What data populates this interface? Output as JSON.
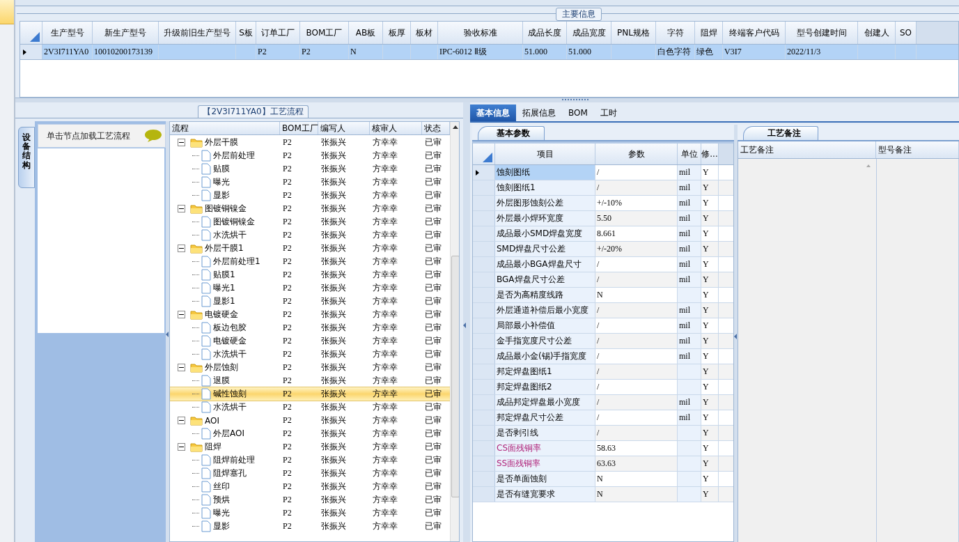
{
  "main_info": {
    "title": "主要信息",
    "columns": [
      "生产型号",
      "新生产型号",
      "升级前旧生产型号",
      "S板",
      "订单工厂",
      "BOM工厂",
      "AB板",
      "板厚",
      "板材",
      "验收标准",
      "成品长度",
      "成品宽度",
      "PNL规格",
      "字符",
      "阻焊",
      "终端客户代码",
      "型号创建时间",
      "创建人",
      "SO"
    ],
    "rows": [
      {
        "selected": true,
        "cells": [
          "2V3I711YA0",
          "10010200173139",
          null,
          null,
          "P2",
          "P2",
          "N",
          null,
          null,
          "IPC-6012 Ⅱ级",
          "51.000",
          "51.000",
          null,
          "白色字符",
          "绿色",
          "V3I7",
          "2022/11/3",
          null,
          null
        ]
      }
    ]
  },
  "process": {
    "title": "【2V3I711YA0】工艺流程",
    "side_tab": "设备结构",
    "hint": "单击节点加载工艺流程",
    "columns": [
      "流程",
      "BOM工厂",
      "编写人",
      "核审人",
      "状态"
    ],
    "tree": [
      {
        "name": "外层干膜",
        "bom": "P2",
        "writer": "张振兴",
        "reviewer": "方幸幸",
        "status": "已审",
        "selected": false,
        "expanded": true,
        "children": [
          {
            "name": "外层前处理",
            "bom": "P2",
            "writer": "张振兴",
            "reviewer": "方幸幸",
            "status": "已审",
            "selected": false
          },
          {
            "name": "贴膜",
            "bom": "P2",
            "writer": "张振兴",
            "reviewer": "方幸幸",
            "status": "已审",
            "selected": false
          },
          {
            "name": "曝光",
            "bom": "P2",
            "writer": "张振兴",
            "reviewer": "方幸幸",
            "status": "已审",
            "selected": false
          },
          {
            "name": "显影",
            "bom": "P2",
            "writer": "张振兴",
            "reviewer": "方幸幸",
            "status": "已审",
            "selected": false
          }
        ]
      },
      {
        "name": "图镀铜镍金",
        "bom": "P2",
        "writer": "张振兴",
        "reviewer": "方幸幸",
        "status": "已审",
        "selected": false,
        "expanded": true,
        "children": [
          {
            "name": "图镀铜镍金",
            "bom": "P2",
            "writer": "张振兴",
            "reviewer": "方幸幸",
            "status": "已审",
            "selected": false
          },
          {
            "name": "水洗烘干",
            "bom": "P2",
            "writer": "张振兴",
            "reviewer": "方幸幸",
            "status": "已审",
            "selected": false
          }
        ]
      },
      {
        "name": "外层干膜1",
        "bom": "P2",
        "writer": "张振兴",
        "reviewer": "方幸幸",
        "status": "已审",
        "selected": false,
        "expanded": true,
        "children": [
          {
            "name": "外层前处理1",
            "bom": "P2",
            "writer": "张振兴",
            "reviewer": "方幸幸",
            "status": "已审",
            "selected": false
          },
          {
            "name": "贴膜1",
            "bom": "P2",
            "writer": "张振兴",
            "reviewer": "方幸幸",
            "status": "已审",
            "selected": false
          },
          {
            "name": "曝光1",
            "bom": "P2",
            "writer": "张振兴",
            "reviewer": "方幸幸",
            "status": "已审",
            "selected": false
          },
          {
            "name": "显影1",
            "bom": "P2",
            "writer": "张振兴",
            "reviewer": "方幸幸",
            "status": "已审",
            "selected": false
          }
        ]
      },
      {
        "name": "电镀硬金",
        "bom": "P2",
        "writer": "张振兴",
        "reviewer": "方幸幸",
        "status": "已审",
        "selected": false,
        "expanded": true,
        "children": [
          {
            "name": "板边包胶",
            "bom": "P2",
            "writer": "张振兴",
            "reviewer": "方幸幸",
            "status": "已审",
            "selected": false
          },
          {
            "name": "电镀硬金",
            "bom": "P2",
            "writer": "张振兴",
            "reviewer": "方幸幸",
            "status": "已审",
            "selected": false
          },
          {
            "name": "水洗烘干",
            "bom": "P2",
            "writer": "张振兴",
            "reviewer": "方幸幸",
            "status": "已审",
            "selected": false
          }
        ]
      },
      {
        "name": "外层蚀刻",
        "bom": "P2",
        "writer": "张振兴",
        "reviewer": "方幸幸",
        "status": "已审",
        "selected": false,
        "expanded": true,
        "children": [
          {
            "name": "退膜",
            "bom": "P2",
            "writer": "张振兴",
            "reviewer": "方幸幸",
            "status": "已审",
            "selected": false
          },
          {
            "name": "碱性蚀刻",
            "bom": "P2",
            "writer": "张振兴",
            "reviewer": "方幸幸",
            "status": "已审",
            "selected": true
          },
          {
            "name": "水洗烘干",
            "bom": "P2",
            "writer": "张振兴",
            "reviewer": "方幸幸",
            "status": "已审",
            "selected": false
          }
        ]
      },
      {
        "name": "AOI",
        "bom": "P2",
        "writer": "张振兴",
        "reviewer": "方幸幸",
        "status": "已审",
        "selected": false,
        "expanded": true,
        "children": [
          {
            "name": "外层AOI",
            "bom": "P2",
            "writer": "张振兴",
            "reviewer": "方幸幸",
            "status": "已审",
            "selected": false
          }
        ]
      },
      {
        "name": "阻焊",
        "bom": "P2",
        "writer": "张振兴",
        "reviewer": "方幸幸",
        "status": "已审",
        "selected": false,
        "expanded": true,
        "children": [
          {
            "name": "阻焊前处理",
            "bom": "P2",
            "writer": "张振兴",
            "reviewer": "方幸幸",
            "status": "已审",
            "selected": false
          },
          {
            "name": "阻焊塞孔",
            "bom": "P2",
            "writer": "张振兴",
            "reviewer": "方幸幸",
            "status": "已审",
            "selected": false
          },
          {
            "name": "丝印",
            "bom": "P2",
            "writer": "张振兴",
            "reviewer": "方幸幸",
            "status": "已审",
            "selected": false
          },
          {
            "name": "预烘",
            "bom": "P2",
            "writer": "张振兴",
            "reviewer": "方幸幸",
            "status": "已审",
            "selected": false
          },
          {
            "name": "曝光",
            "bom": "P2",
            "writer": "张振兴",
            "reviewer": "方幸幸",
            "status": "已审",
            "selected": false
          },
          {
            "name": "显影",
            "bom": "P2",
            "writer": "张振兴",
            "reviewer": "方幸幸",
            "status": "已审",
            "selected": false
          }
        ]
      }
    ]
  },
  "detail": {
    "tabs": [
      {
        "label": "基本信息",
        "selected": true
      },
      {
        "label": "拓展信息",
        "selected": false
      },
      {
        "label": "BOM",
        "selected": false
      },
      {
        "label": "工时",
        "selected": false
      }
    ],
    "subtab": "基本参数",
    "columns": [
      "项目",
      "参数",
      "单位",
      "修..."
    ],
    "rows": [
      {
        "item": "蚀刻图纸",
        "value": "/",
        "unit": "mil",
        "mod": "Y",
        "selected": true,
        "highlighted": false
      },
      {
        "item": "蚀刻图纸1",
        "value": "/",
        "unit": "mil",
        "mod": "Y",
        "selected": false,
        "highlighted": false
      },
      {
        "item": "外层图形蚀刻公差",
        "value": "+/-10%",
        "unit": "mil",
        "mod": "Y",
        "selected": false,
        "highlighted": false
      },
      {
        "item": "外层最小焊环宽度",
        "value": "5.50",
        "unit": "mil",
        "mod": "Y",
        "selected": false,
        "highlighted": false
      },
      {
        "item": "成品最小SMD焊盘宽度",
        "value": "8.661",
        "unit": "mil",
        "mod": "Y",
        "selected": false,
        "highlighted": false
      },
      {
        "item": "SMD焊盘尺寸公差",
        "value": "+/-20%",
        "unit": "mil",
        "mod": "Y",
        "selected": false,
        "highlighted": false
      },
      {
        "item": "成品最小BGA焊盘尺寸",
        "value": "/",
        "unit": "mil",
        "mod": "Y",
        "selected": false,
        "highlighted": false
      },
      {
        "item": "BGA焊盘尺寸公差",
        "value": "/",
        "unit": "mil",
        "mod": "Y",
        "selected": false,
        "highlighted": false
      },
      {
        "item": "是否为高精度线路",
        "value": "N",
        "mod": "Y",
        "selected": false,
        "highlighted": false
      },
      {
        "item": "外层通道补偿后最小宽度",
        "value": "/",
        "unit": "mil",
        "mod": "Y",
        "selected": false,
        "highlighted": false
      },
      {
        "item": "局部最小补偿值",
        "value": "/",
        "unit": "mil",
        "mod": "Y",
        "selected": false,
        "highlighted": false
      },
      {
        "item": "金手指宽度尺寸公差",
        "value": "/",
        "unit": "mil",
        "mod": "Y",
        "selected": false,
        "highlighted": false
      },
      {
        "item": "成品最小金(锡)手指宽度",
        "value": "/",
        "unit": "mil",
        "mod": "Y",
        "selected": false,
        "highlighted": false
      },
      {
        "item": "邦定焊盘图纸1",
        "value": "/",
        "mod": "Y",
        "selected": false,
        "highlighted": false
      },
      {
        "item": "邦定焊盘图纸2",
        "value": "/",
        "mod": "Y",
        "selected": false,
        "highlighted": false
      },
      {
        "item": "成品邦定焊盘最小宽度",
        "value": "/",
        "unit": "mil",
        "mod": "Y",
        "selected": false,
        "highlighted": false
      },
      {
        "item": "邦定焊盘尺寸公差",
        "value": "/",
        "unit": "mil",
        "mod": "Y",
        "selected": false,
        "highlighted": false
      },
      {
        "item": "是否剥引线",
        "value": "/",
        "mod": "Y",
        "selected": false,
        "highlighted": false
      },
      {
        "item": "CS面残铜率",
        "value": "58.63",
        "mod": "Y",
        "selected": false,
        "highlighted": true
      },
      {
        "item": "SS面残铜率",
        "value": "63.63",
        "mod": "Y",
        "selected": false,
        "highlighted": true
      },
      {
        "item": "是否单面蚀刻",
        "value": "N",
        "mod": "Y",
        "selected": false,
        "highlighted": false
      },
      {
        "item": "是否有缝宽要求",
        "value": "N",
        "mod": "Y",
        "selected": false,
        "highlighted": false
      }
    ]
  },
  "notes": {
    "tab": "工艺备注",
    "columns": [
      "工艺备注",
      "型号备注"
    ]
  }
}
